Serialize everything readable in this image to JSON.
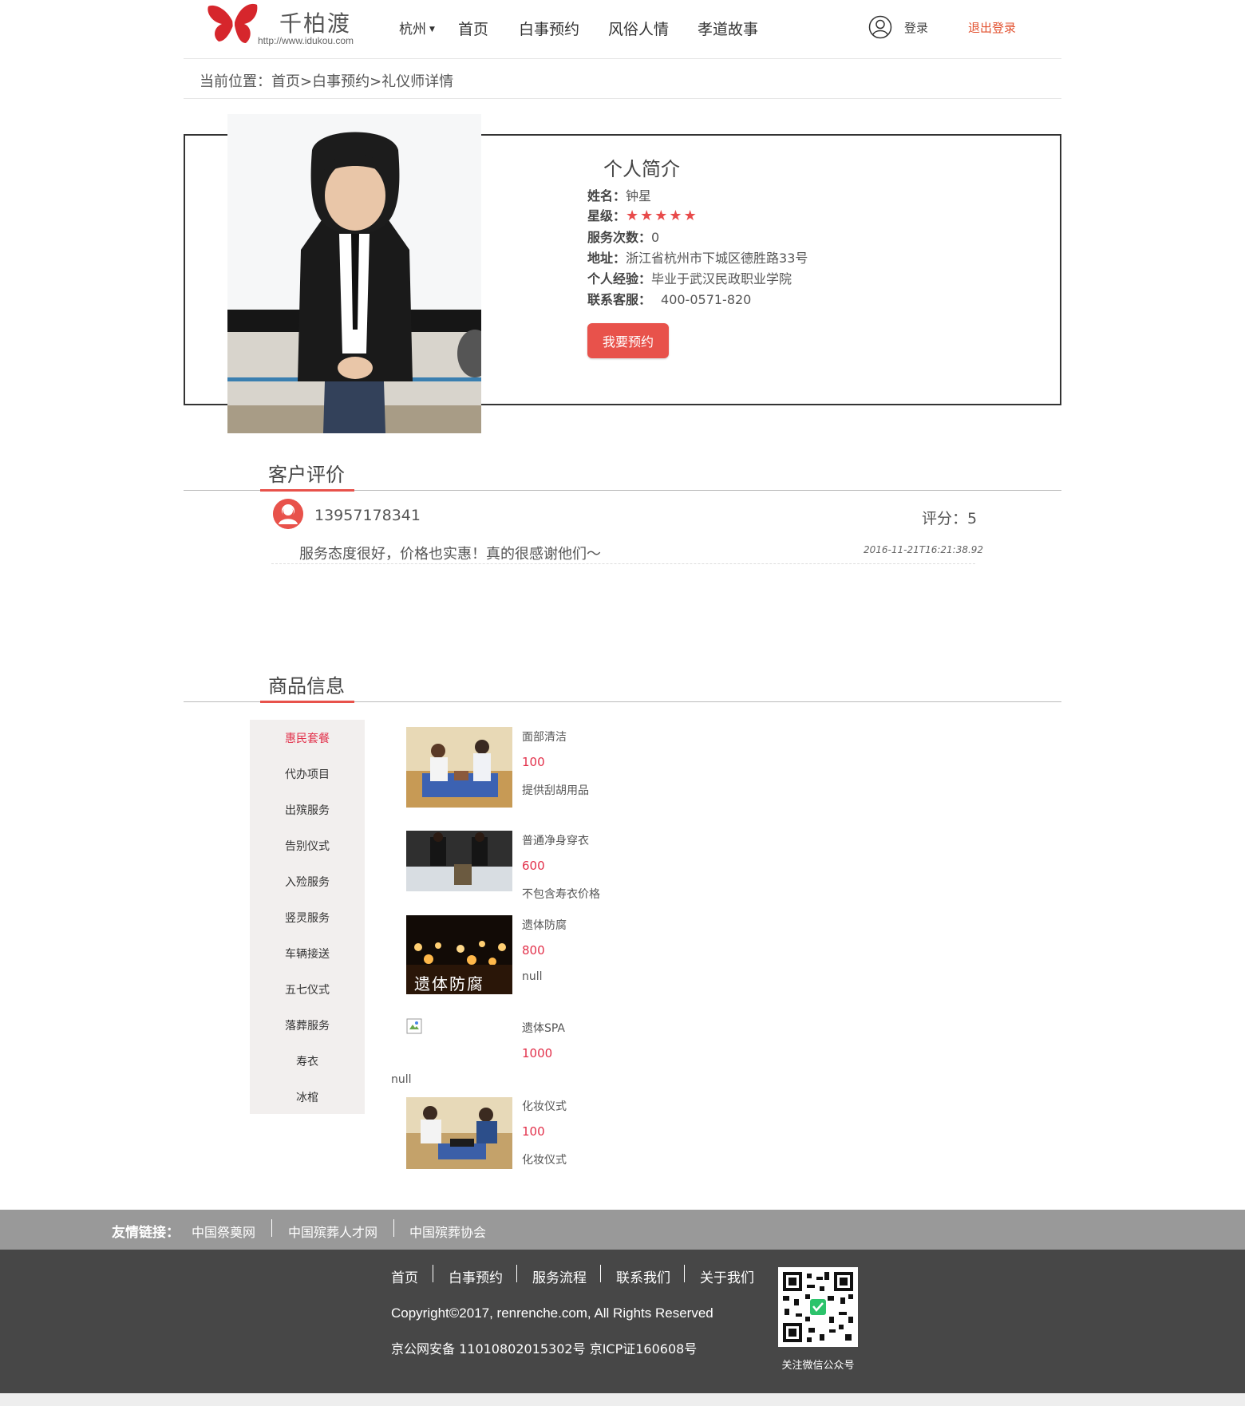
{
  "header": {
    "brand_name": "千柏渡",
    "brand_url": "http://www.idukou.com",
    "city": "杭州",
    "nav": [
      "首页",
      "白事预约",
      "风俗人情",
      "孝道故事"
    ],
    "login": "登录",
    "logout": "退出登录"
  },
  "breadcrumb": "当前位置：首页>白事预约>礼仪师详情",
  "profile": {
    "title": "个人简介",
    "name_label": "姓名：",
    "name": "钟星",
    "star_label": "星级：",
    "stars": "★★★★★",
    "rating": 5,
    "service_label": "服务次数：",
    "service_count": "0",
    "address_label": "地址：",
    "address": "浙江省杭州市下城区德胜路33号",
    "experience_label": "个人经验：",
    "experience": "毕业于武汉民政职业学院",
    "hotline_label": "联系客服：",
    "hotline": "400-0571-820",
    "book_button": "我要预约"
  },
  "reviews": {
    "title": "客户评价",
    "items": [
      {
        "user": "13957178341",
        "score": "评分：5",
        "text": "服务态度很好，价格也实惠！真的很感谢他们～",
        "time": "2016-11-21T16:21:38.92"
      }
    ]
  },
  "goods": {
    "title": "商品信息",
    "categories": [
      "惠民套餐",
      "代办项目",
      "出殡服务",
      "告别仪式",
      "入殓服务",
      "竖灵服务",
      "车辆接送",
      "五七仪式",
      "落葬服务",
      "寿衣",
      "冰棺"
    ],
    "active_category": "惠民套餐",
    "items": [
      {
        "name": "面部清洁",
        "price": "100",
        "desc": "提供刮胡用品"
      },
      {
        "name": "普通净身穿衣",
        "price": "600",
        "desc": "不包含寿衣价格"
      },
      {
        "name": "遗体防腐",
        "price": "800",
        "desc": "null",
        "image_text": "遗体防腐"
      },
      {
        "name": "遗体SPA",
        "price": "1000",
        "desc": "null"
      },
      {
        "name": "化妆仪式",
        "price": "100",
        "desc": "化妆仪式"
      }
    ]
  },
  "footer": {
    "links_label": "友情链接：",
    "links": [
      "中国祭奠网",
      "中国殡葬人才网",
      "中国殡葬协会"
    ],
    "nav": [
      "首页",
      "白事预约",
      "服务流程",
      "联系我们",
      "关于我们"
    ],
    "copyright": "Copyright©2017, renrenche.com, All Rights Reserved",
    "icp": "京公网安备 11010802015302号 京ICP证160608号",
    "qr_caption": "关注微信公众号"
  },
  "colors": {
    "accent": "#e8524b",
    "price": "#e2304a",
    "logout": "#e2502e",
    "footer_dark": "#474747",
    "footer_links": "#999999"
  },
  "icons": [
    "butterfly-logo",
    "user-icon",
    "avatar-icon",
    "qr-code"
  ]
}
